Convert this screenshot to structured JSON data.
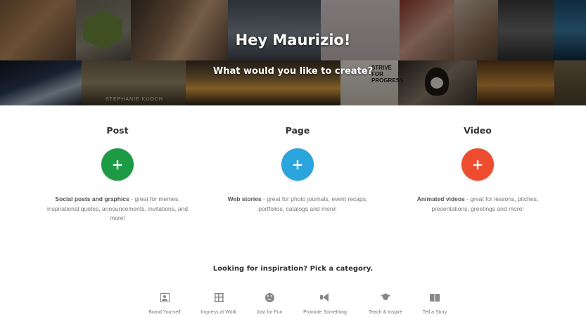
{
  "hero": {
    "greeting": "Hey Maurizio!",
    "subtitle": "What would you like to create?",
    "photo_text": {
      "stephanie": "STEPHANIE KUOCH",
      "strive": "STRIVE FOR PROGRESS"
    }
  },
  "create_options": [
    {
      "title": "Post",
      "button_label": "+",
      "accent_color": "#1d9b44",
      "desc_bold": "Social posts and graphics",
      "desc_rest": " - great for memes, inspirational quotes, announcements, invitations, and more!"
    },
    {
      "title": "Page",
      "button_label": "+",
      "accent_color": "#2aa4dc",
      "desc_bold": "Web stories",
      "desc_rest": " - great for photo journals, event recaps, portfolios, catalogs and more!"
    },
    {
      "title": "Video",
      "button_label": "+",
      "accent_color": "#ee4c2f",
      "desc_bold": "Animated videos",
      "desc_rest": " - great for lessons, pitches, presentations, greetings and more!"
    }
  ],
  "inspiration": {
    "heading": "Looking for inspiration? Pick a category.",
    "categories": [
      {
        "label": "Brand Yourself",
        "icon": "portrait-icon"
      },
      {
        "label": "Impress at Work",
        "icon": "grid-icon"
      },
      {
        "label": "Just for Fun",
        "icon": "smiley-icon"
      },
      {
        "label": "Promote Something",
        "icon": "megaphone-icon"
      },
      {
        "label": "Teach & Inspire",
        "icon": "graduation-cap-icon"
      },
      {
        "label": "Tell a Story",
        "icon": "book-icon"
      }
    ]
  }
}
